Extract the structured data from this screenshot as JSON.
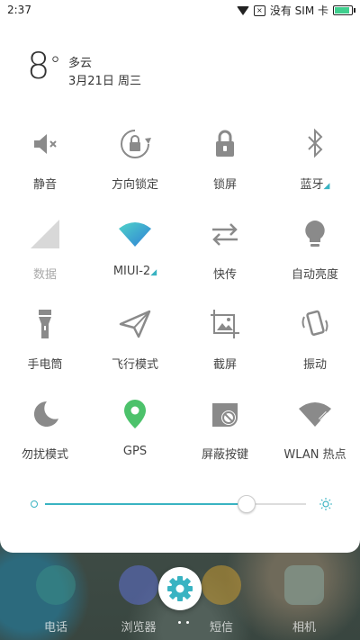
{
  "status_bar": {
    "time": "2:37",
    "carrier": "没有 SIM 卡"
  },
  "weather": {
    "temperature": "8",
    "degree_symbol": "°",
    "condition": "多云",
    "date": "3月21日 周三"
  },
  "tiles": [
    {
      "label": "静音",
      "icon": "mute-icon",
      "active": false
    },
    {
      "label": "方向锁定",
      "icon": "rotation-lock-icon",
      "active": false
    },
    {
      "label": "锁屏",
      "icon": "lock-icon",
      "active": false
    },
    {
      "label": "蓝牙",
      "icon": "bluetooth-icon",
      "active": false
    },
    {
      "label": "数据",
      "icon": "mobile-data-icon",
      "active": false
    },
    {
      "label": "MIUI-2",
      "icon": "wifi-icon",
      "active": true
    },
    {
      "label": "快传",
      "icon": "transfer-icon",
      "active": false
    },
    {
      "label": "自动亮度",
      "icon": "bulb-icon",
      "active": false
    },
    {
      "label": "手电筒",
      "icon": "flashlight-icon",
      "active": false
    },
    {
      "label": "飞行模式",
      "icon": "airplane-icon",
      "active": false
    },
    {
      "label": "截屏",
      "icon": "screenshot-icon",
      "active": false
    },
    {
      "label": "振动",
      "icon": "vibrate-icon",
      "active": false
    },
    {
      "label": "勿扰模式",
      "icon": "moon-icon",
      "active": false
    },
    {
      "label": "GPS",
      "icon": "gps-icon",
      "active": true
    },
    {
      "label": "屏蔽按键",
      "icon": "block-keys-icon",
      "active": false
    },
    {
      "label": "WLAN 热点",
      "icon": "hotspot-icon",
      "active": false
    }
  ],
  "brightness": {
    "level": 0.77
  },
  "dock": {
    "apps": [
      {
        "label": "电话",
        "icon": "phone-icon"
      },
      {
        "label": "浏览器",
        "icon": "browser-icon"
      },
      {
        "label": "短信",
        "icon": "messages-icon"
      },
      {
        "label": "相机",
        "icon": "camera-icon"
      }
    ]
  },
  "colors": {
    "accent": "#39b3c2",
    "gps_green": "#4cc26b",
    "icon_gray": "#8a8a8a"
  }
}
